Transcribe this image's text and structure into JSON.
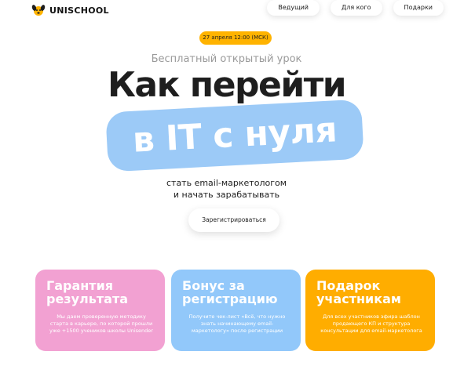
{
  "header": {
    "logo_text": "UNISCHOOL",
    "logo_icon": "dog-face-icon",
    "nav": [
      {
        "label": "Ведущий"
      },
      {
        "label": "Для кого"
      },
      {
        "label": "Подарки"
      }
    ]
  },
  "hero": {
    "date": "27 апреля 12:00 (МСК)",
    "subtitle": "Бесплатный открытый урок",
    "headline_line1": "Как перейти",
    "headline_line2": "в IT с нуля",
    "description": [
      "стать email-маркетологом",
      "и начать зарабатывать"
    ],
    "cta_label": "Зарегистрироваться"
  },
  "cards": [
    {
      "title": [
        "Гарантия",
        "результата"
      ],
      "text": [
        "Мы даем проверенную методику",
        "старта в карьере, по которой прошли",
        "уже +1500 учеников школы Unisender"
      ]
    },
    {
      "title": [
        "Бонус за",
        "регистрацию"
      ],
      "text": [
        "Получите чек-лист «Всё, что нужно",
        "знать начинающему email-",
        "маркетологу» после регистрации"
      ]
    },
    {
      "title": [
        "Подарок",
        "участникам"
      ],
      "text": [
        "Для всех участников эфира шаблон",
        "продающего КП и структура",
        "консультации для email-маркетолога"
      ]
    }
  ],
  "colors": {
    "accent_orange": "#ffb300",
    "highlight_blue": "#9ccaf7",
    "card_pink": "#f2a1d2",
    "card_blue": "#92c8fa",
    "card_orange": "#ffad00"
  }
}
